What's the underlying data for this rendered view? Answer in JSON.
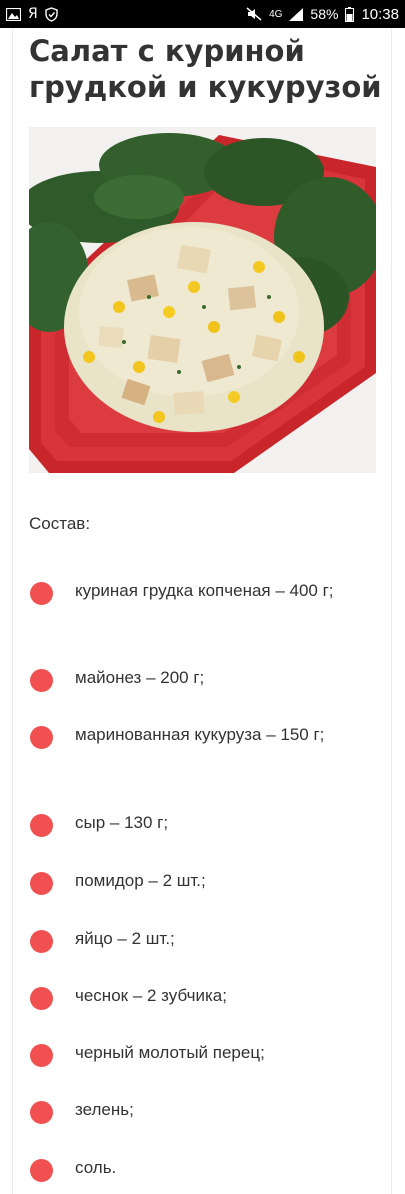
{
  "status_bar": {
    "left_icons": [
      "image-icon",
      "yandex-icon",
      "shield-icon"
    ],
    "yandex_letter": "Я",
    "network": "4G",
    "battery": "58%",
    "time": "10:38"
  },
  "article": {
    "title": "Салат с куриной грудкой и кукурузой",
    "image_alt": "Салат с куриной грудкой и кукурузой",
    "section_label": "Состав:",
    "ingredients": [
      "куриная грудка копченая – 400 г;",
      "майонез – 200 г;",
      "маринованная кукуруза – 150 г;",
      "сыр – 130 г;",
      "помидор – 2 шт.;",
      "яйцо – 2 шт.;",
      "чеснок – 2 зубчика;",
      "черный молотый перец;",
      "зелень;",
      "соль."
    ]
  },
  "colors": {
    "bullet": "#f05050",
    "text": "#333333",
    "status_bar": "#000000"
  }
}
